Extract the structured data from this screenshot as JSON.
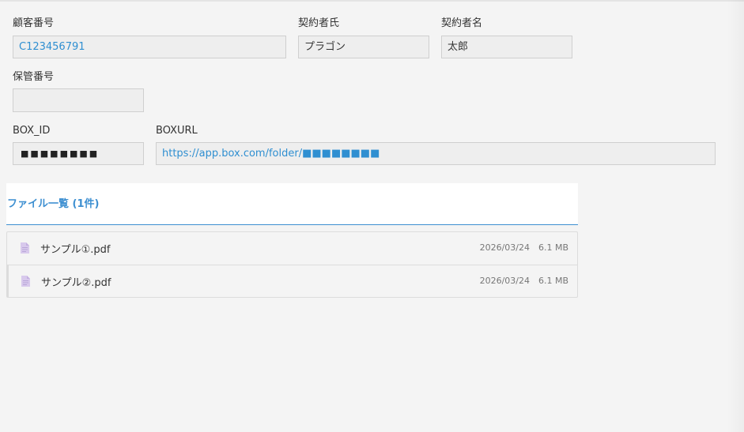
{
  "form": {
    "customer_number": {
      "label": "顧客番号",
      "value": "C123456791"
    },
    "contract_last_name": {
      "label": "契約者氏",
      "value": "プラゴン"
    },
    "contract_first_name": {
      "label": "契約者名",
      "value": "太郎"
    },
    "storage_number": {
      "label": "保管番号",
      "value": ""
    },
    "box_id": {
      "label": "BOX_ID",
      "value": "■■■■■■■■"
    },
    "box_url": {
      "label": "BOXURL",
      "value": "https://app.box.com/folder/■■■■■■■■"
    }
  },
  "files": {
    "title": "ファイル一覧 (1件)",
    "items": [
      {
        "name": "サンプル①.pdf",
        "date": "2026/03/24",
        "size": "6.1 MB",
        "icon": "pdf-file-icon"
      },
      {
        "name": "サンプル②.pdf",
        "date": "2026/03/24",
        "size": "6.1 MB",
        "icon": "pdf-file-icon"
      }
    ]
  },
  "colors": {
    "accent": "#3d8fd1",
    "link": "#2f8fd1",
    "background": "#f4f4f4",
    "field_bg": "#eeeeee",
    "icon": "#d8c9ec"
  }
}
